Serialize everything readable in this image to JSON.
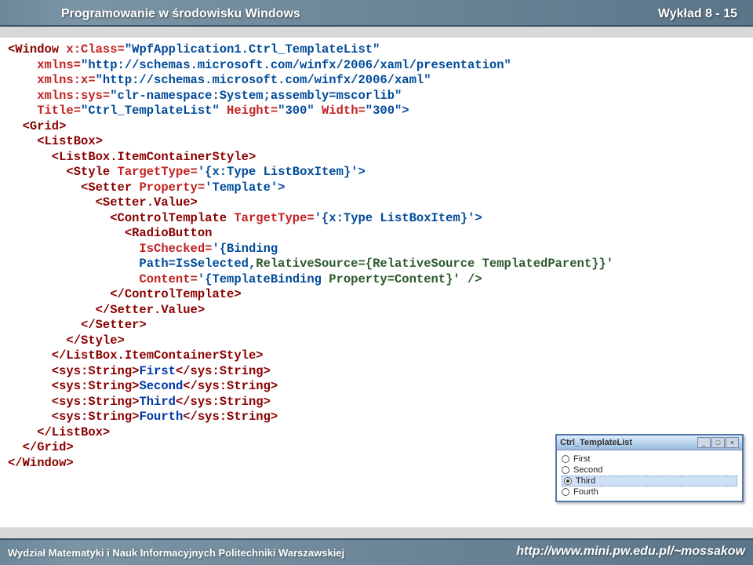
{
  "header": {
    "title": "Programowanie w środowisku Windows",
    "right": "Wykład 8 - 15"
  },
  "footer": {
    "left": "Wydział Matematyki i Nauk Informacyjnych Politechniki Warszawskiej",
    "right": "http://www.mini.pw.edu.pl/~mossakow"
  },
  "code": {
    "l01a": "<Window ",
    "l01b": "x:Class=",
    "l01c": "\"WpfApplication1.Ctrl_TemplateList\"",
    "l02a": "    xmlns=",
    "l02b": "\"http://schemas.microsoft.com/winfx/2006/xaml/presentation\"",
    "l03a": "    xmlns:x=",
    "l03b": "\"http://schemas.microsoft.com/winfx/2006/xaml\"",
    "l04a": "    xmlns:sys=",
    "l04b": "\"clr-namespace:System;assembly=mscorlib\"",
    "l05a": "    Title=",
    "l05b": "\"Ctrl_TemplateList\" ",
    "l05c": "Height=",
    "l05d": "\"300\" ",
    "l05e": "Width=",
    "l05f": "\"300\">",
    "l06": "  <Grid>",
    "l07": "    <ListBox>",
    "l08": "      <ListBox.ItemContainerStyle>",
    "l09a": "        <Style ",
    "l09b": "TargetType=",
    "l09c": "'{x:Type ListBoxItem}'>",
    "l10a": "          <Setter ",
    "l10b": "Property=",
    "l10c": "'Template'>",
    "l11": "            <Setter.Value>",
    "l12a": "              <ControlTemplate ",
    "l12b": "TargetType=",
    "l12c": "'{x:Type ListBoxItem}'>",
    "l13": "                <RadioButton",
    "l14a": "                  IsChecked=",
    "l14b": "'{Binding",
    "l15a": "                  Path=IsSelected,",
    "l15b": "RelativeSource={RelativeSource TemplatedParent}}'",
    "l16a": "                  Content=",
    "l16b": "'{TemplateBinding ",
    "l16c": "Property=Content}' />",
    "l17": "              </ControlTemplate>",
    "l18": "            </Setter.Value>",
    "l19": "          </Setter>",
    "l20": "        </Style>",
    "l21": "      </ListBox.ItemContainerStyle>",
    "l22a": "      <sys:String>",
    "l22b": "First",
    "l22c": "</sys:String>",
    "l23a": "      <sys:String>",
    "l23b": "Second",
    "l23c": "</sys:String>",
    "l24a": "      <sys:String>",
    "l24b": "Third",
    "l24c": "</sys:String>",
    "l25a": "      <sys:String>",
    "l25b": "Fourth",
    "l25c": "</sys:String>",
    "l26": "    </ListBox>",
    "l27": "  </Grid>",
    "l28": "</Window>"
  },
  "mini": {
    "title": "Ctrl_TemplateList",
    "items": {
      "i0": "First",
      "i1": "Second",
      "i2": "Third",
      "i3": "Fourth"
    },
    "selected_index": 2,
    "btn_min": "_",
    "btn_max": "□",
    "btn_close": "×"
  }
}
